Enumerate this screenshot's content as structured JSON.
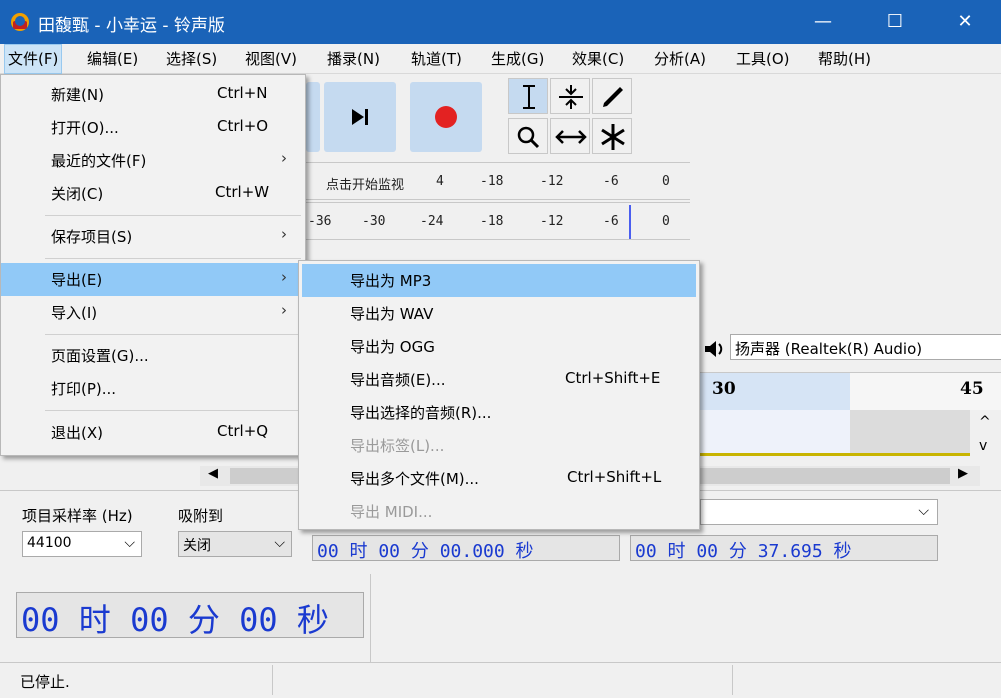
{
  "window": {
    "title": "田馥甄 - 小幸运 - 铃声版",
    "minimize": "—",
    "maximize": "☐",
    "close": "✕"
  },
  "menubar": [
    {
      "label": "文件(F)",
      "name": "menu-file"
    },
    {
      "label": "编辑(E)",
      "name": "menu-edit"
    },
    {
      "label": "选择(S)",
      "name": "menu-select"
    },
    {
      "label": "视图(V)",
      "name": "menu-view"
    },
    {
      "label": "播录(N)",
      "name": "menu-transport"
    },
    {
      "label": "轨道(T)",
      "name": "menu-tracks"
    },
    {
      "label": "生成(G)",
      "name": "menu-generate"
    },
    {
      "label": "效果(C)",
      "name": "menu-effect"
    },
    {
      "label": "分析(A)",
      "name": "menu-analyze"
    },
    {
      "label": "工具(O)",
      "name": "menu-tools"
    },
    {
      "label": "帮助(H)",
      "name": "menu-help"
    }
  ],
  "file_menu": [
    {
      "label": "新建(N)",
      "shortcut": "Ctrl+N"
    },
    {
      "label": "打开(O)...",
      "shortcut": "Ctrl+O"
    },
    {
      "label": "最近的文件(F)",
      "submenu": true
    },
    {
      "label": "关闭(C)",
      "shortcut": "Ctrl+W"
    },
    {
      "label": "保存项目(S)",
      "submenu": true
    },
    {
      "label": "导出(E)",
      "submenu": true,
      "selected": true
    },
    {
      "label": "导入(I)",
      "submenu": true
    },
    {
      "label": "页面设置(G)..."
    },
    {
      "label": "打印(P)..."
    },
    {
      "label": "退出(X)",
      "shortcut": "Ctrl+Q"
    }
  ],
  "export_menu": [
    {
      "label": "导出为 MP3",
      "selected": true
    },
    {
      "label": "导出为 WAV"
    },
    {
      "label": "导出为 OGG"
    },
    {
      "label": "导出音频(E)...",
      "shortcut": "Ctrl+Shift+E"
    },
    {
      "label": "导出选择的音频(R)..."
    },
    {
      "label": "导出标签(L)...",
      "disabled": true
    },
    {
      "label": "导出多个文件(M)...",
      "shortcut": "Ctrl+Shift+L"
    },
    {
      "label": "导出 MIDI...",
      "disabled": true
    }
  ],
  "meters": {
    "record_prompt": "点击开始监视",
    "record_ticks": [
      "4",
      "-18",
      "-12",
      "-6",
      "0"
    ],
    "play_ticks": [
      "-36",
      "-30",
      "-24",
      "-18",
      "-12",
      "-6",
      "0"
    ]
  },
  "device": {
    "output": "扬声器 (Realtek(R) Audio)"
  },
  "timeline": {
    "mark_30": "30",
    "mark_45": "45"
  },
  "selection_bar": {
    "rate_label": "项目采样率 (Hz)",
    "rate_value": "44100",
    "snap_label": "吸附到",
    "snap_value": "关闭",
    "start_time": "00 时 00 分 00.000 秒",
    "end_time": "00 时 00 分 37.695 秒"
  },
  "big_time": "00 时 00 分 00 秒",
  "status": {
    "text": "已停止."
  },
  "colors": {
    "titlebar": "#1a63b8",
    "menu_highlight": "#91c9f7",
    "timecode": "#1a3ad0"
  }
}
